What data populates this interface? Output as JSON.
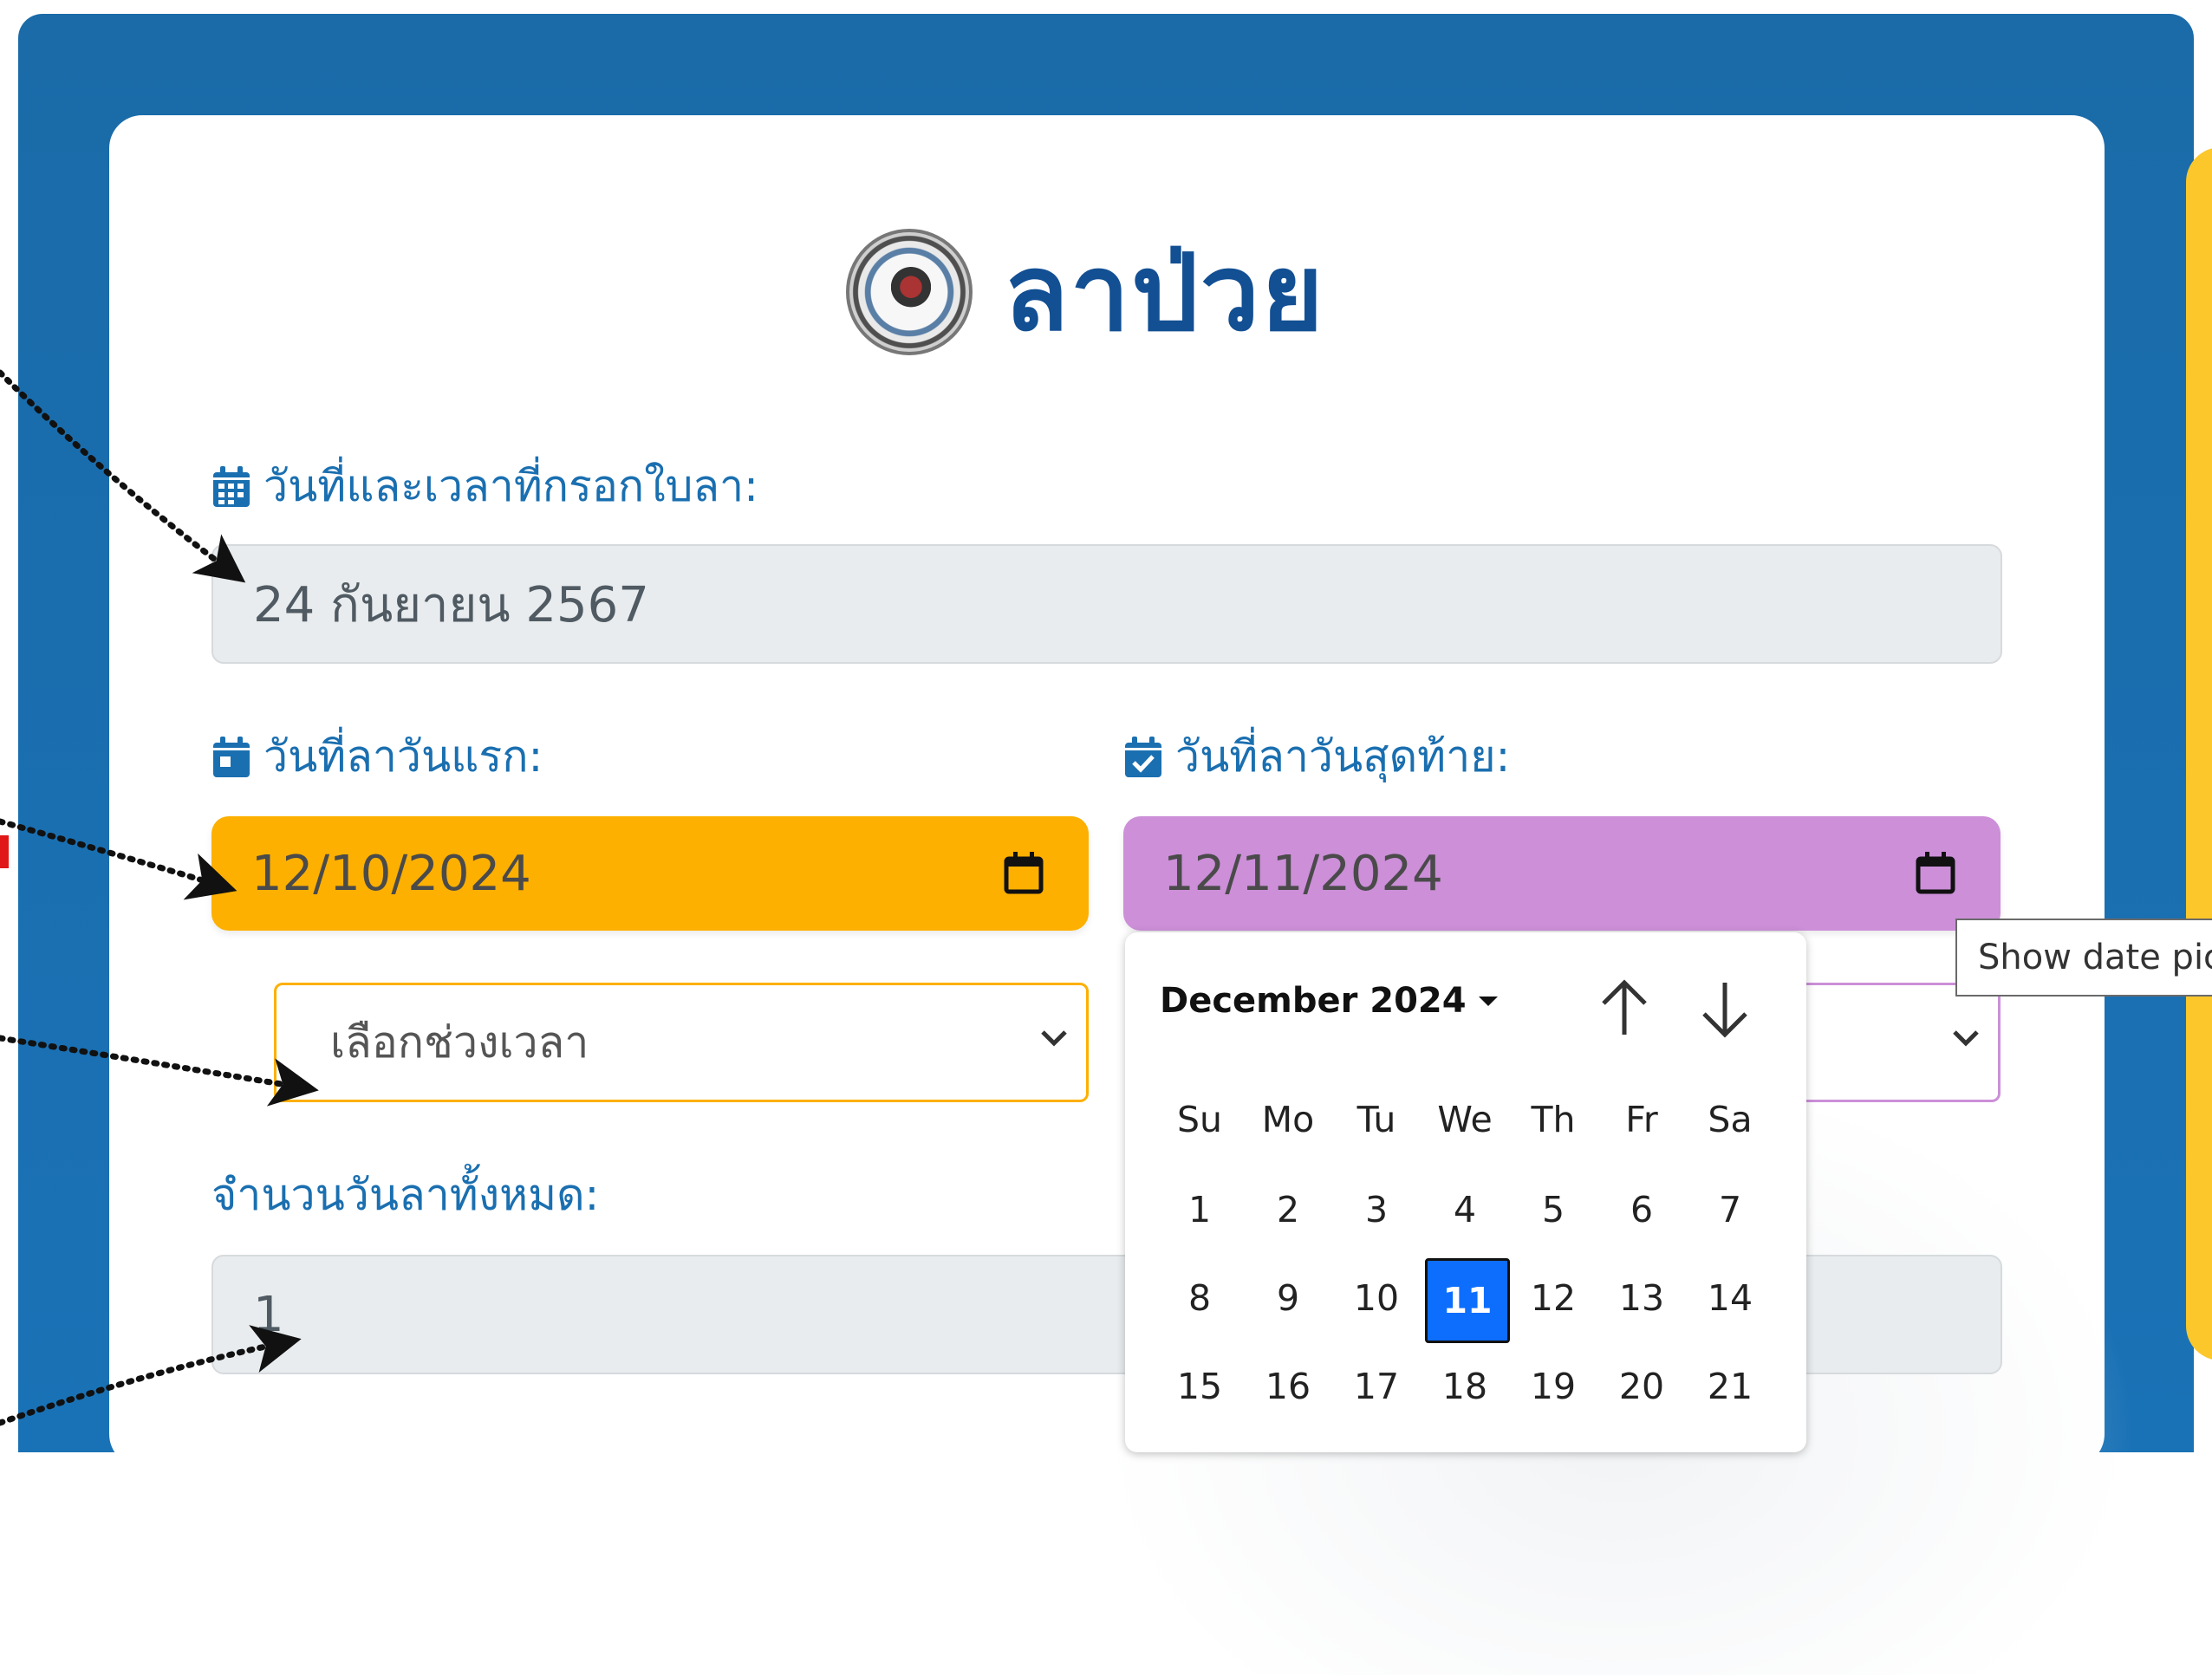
{
  "form": {
    "title": "ลาป่วย",
    "submit_date_label": "วันที่และเวลาที่กรอกใบลา:",
    "submit_date_value": "24 กันยายน 2567",
    "start_date_label": "วันที่ลาวันแรก:",
    "start_date_value": "12/10/2024",
    "end_date_label": "วันที่ลาวันสุดท้าย:",
    "end_date_value": "12/11/2024",
    "time_period_placeholder": "เลือกช่วงเวลา",
    "total_days_label": "จำนวนวันลาทั้งหมด:",
    "total_days_value": "1"
  },
  "tooltip": {
    "text": "Show date picker"
  },
  "datepicker": {
    "month_label": "December 2024",
    "weekdays": [
      "Su",
      "Mo",
      "Tu",
      "We",
      "Th",
      "Fr",
      "Sa"
    ],
    "weeks": [
      [
        "1",
        "2",
        "3",
        "4",
        "5",
        "6",
        "7"
      ],
      [
        "8",
        "9",
        "10",
        "11",
        "12",
        "13",
        "14"
      ],
      [
        "15",
        "16",
        "17",
        "18",
        "19",
        "20",
        "21"
      ]
    ],
    "selected_day": "11"
  },
  "colors": {
    "header_blue": "#1a6ba8",
    "title_blue": "#124f93",
    "start_date_bg": "#fdb000",
    "end_date_bg": "#cc8fd8",
    "selected_day_bg": "#0d6efd"
  },
  "icons": {
    "submit_date": "calendar-icon",
    "start_date": "calendar-day-icon",
    "end_date": "calendar-check-icon",
    "date_button": "calendar-outline-icon",
    "month_menu": "caret-down-icon",
    "prev_month": "arrow-up-icon",
    "next_month": "arrow-down-icon"
  }
}
